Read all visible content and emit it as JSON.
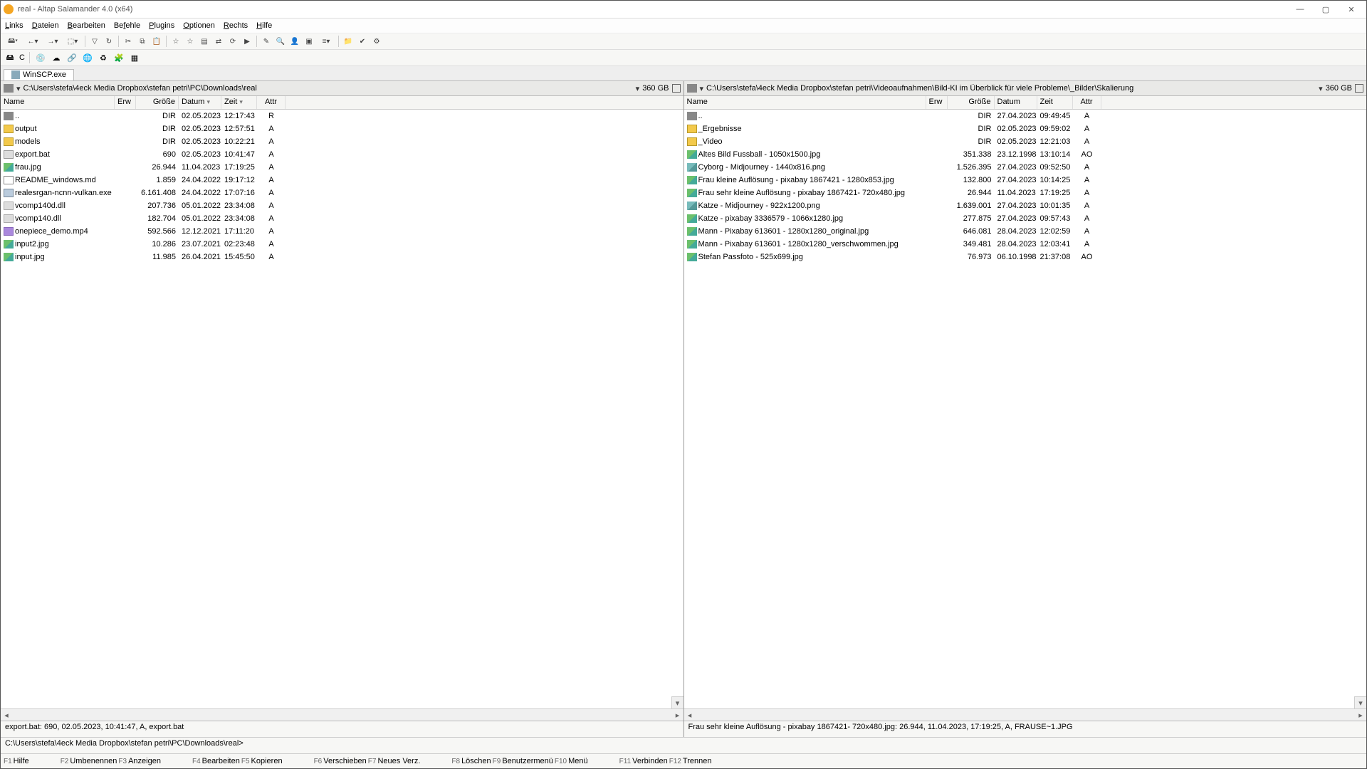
{
  "window": {
    "title": "real - Altap Salamander 4.0 (x64)"
  },
  "menu": {
    "links": "Links",
    "dateien": "Dateien",
    "bearbeiten": "Bearbeiten",
    "befehle": "Befehle",
    "plugins": "Plugins",
    "optionen": "Optionen",
    "rechts": "Rechts",
    "hilfe": "Hilfe"
  },
  "drivebar": {
    "c_label": "C"
  },
  "tab": {
    "winscp": "WinSCP.exe"
  },
  "left": {
    "path": "C:\\Users\\stefa\\4eck Media Dropbox\\stefan petri\\PC\\Downloads\\real",
    "free": "360 GB",
    "cols": {
      "name": "Name",
      "ext": "Erw",
      "size": "Größe",
      "date": "Datum",
      "time": "Zeit",
      "attr": "Attr"
    },
    "rows": [
      {
        "icon": "up",
        "name": "..",
        "size": "DIR",
        "date": "02.05.2023",
        "time": "12:17:43",
        "attr": "R"
      },
      {
        "icon": "folder",
        "name": "output",
        "size": "DIR",
        "date": "02.05.2023",
        "time": "12:57:51",
        "attr": "A"
      },
      {
        "icon": "folder",
        "name": "models",
        "size": "DIR",
        "date": "02.05.2023",
        "time": "10:22:21",
        "attr": "A"
      },
      {
        "icon": "bat",
        "name": "export.bat",
        "size": "690",
        "date": "02.05.2023",
        "time": "10:41:47",
        "attr": "A"
      },
      {
        "icon": "img",
        "name": "frau.jpg",
        "size": "26.944",
        "date": "11.04.2023",
        "time": "17:19:25",
        "attr": "A"
      },
      {
        "icon": "txt",
        "name": "README_windows.md",
        "size": "1.859",
        "date": "24.04.2022",
        "time": "19:17:12",
        "attr": "A"
      },
      {
        "icon": "exe",
        "name": "realesrgan-ncnn-vulkan.exe",
        "size": "6.161.408",
        "date": "24.04.2022",
        "time": "17:07:16",
        "attr": "A"
      },
      {
        "icon": "dll",
        "name": "vcomp140d.dll",
        "size": "207.736",
        "date": "05.01.2022",
        "time": "23:34:08",
        "attr": "A"
      },
      {
        "icon": "dll",
        "name": "vcomp140.dll",
        "size": "182.704",
        "date": "05.01.2022",
        "time": "23:34:08",
        "attr": "A"
      },
      {
        "icon": "mp4",
        "name": "onepiece_demo.mp4",
        "size": "592.566",
        "date": "12.12.2021",
        "time": "17:11:20",
        "attr": "A"
      },
      {
        "icon": "img",
        "name": "input2.jpg",
        "size": "10.286",
        "date": "23.07.2021",
        "time": "02:23:48",
        "attr": "A"
      },
      {
        "icon": "img",
        "name": "input.jpg",
        "size": "11.985",
        "date": "26.04.2021",
        "time": "15:45:50",
        "attr": "A"
      }
    ],
    "info": "export.bat: 690, 02.05.2023, 10:41:47, A, export.bat"
  },
  "right": {
    "path": "C:\\Users\\stefa\\4eck Media Dropbox\\stefan petri\\Videoaufnahmen\\Bild-KI im Überblick für viele Probleme\\_Bilder\\Skalierung",
    "free": "360 GB",
    "cols": {
      "name": "Name",
      "ext": "Erw",
      "size": "Größe",
      "date": "Datum",
      "time": "Zeit",
      "attr": "Attr"
    },
    "rows": [
      {
        "icon": "up",
        "name": "..",
        "size": "DIR",
        "date": "27.04.2023",
        "time": "09:49:45",
        "attr": "A"
      },
      {
        "icon": "folder",
        "name": "_Ergebnisse",
        "size": "DIR",
        "date": "02.05.2023",
        "time": "09:59:02",
        "attr": "A"
      },
      {
        "icon": "folder",
        "name": "_Video",
        "size": "DIR",
        "date": "02.05.2023",
        "time": "12:21:03",
        "attr": "A"
      },
      {
        "icon": "img",
        "name": "Altes Bild Fussball - 1050x1500.jpg",
        "size": "351.338",
        "date": "23.12.1998",
        "time": "13:10:14",
        "attr": "AO"
      },
      {
        "icon": "png",
        "name": "Cyborg - Midjourney - 1440x816.png",
        "size": "1.526.395",
        "date": "27.04.2023",
        "time": "09:52:50",
        "attr": "A"
      },
      {
        "icon": "img",
        "name": "Frau kleine Auflösung - pixabay 1867421 - 1280x853.jpg",
        "size": "132.800",
        "date": "27.04.2023",
        "time": "10:14:25",
        "attr": "A"
      },
      {
        "icon": "img",
        "name": "Frau sehr kleine Auflösung - pixabay 1867421- 720x480.jpg",
        "size": "26.944",
        "date": "11.04.2023",
        "time": "17:19:25",
        "attr": "A"
      },
      {
        "icon": "png",
        "name": "Katze - Midjourney - 922x1200.png",
        "size": "1.639.001",
        "date": "27.04.2023",
        "time": "10:01:35",
        "attr": "A"
      },
      {
        "icon": "img",
        "name": "Katze - pixabay 3336579 - 1066x1280.jpg",
        "size": "277.875",
        "date": "27.04.2023",
        "time": "09:57:43",
        "attr": "A"
      },
      {
        "icon": "img",
        "name": "Mann - Pixabay 613601 - 1280x1280_original.jpg",
        "size": "646.081",
        "date": "28.04.2023",
        "time": "12:02:59",
        "attr": "A"
      },
      {
        "icon": "img",
        "name": "Mann - Pixabay 613601 - 1280x1280_verschwommen.jpg",
        "size": "349.481",
        "date": "28.04.2023",
        "time": "12:03:41",
        "attr": "A"
      },
      {
        "icon": "img",
        "name": "Stefan Passfoto - 525x699.jpg",
        "size": "76.973",
        "date": "06.10.1998",
        "time": "21:37:08",
        "attr": "AO"
      }
    ],
    "info": "Frau sehr kleine Auflösung - pixabay 1867421- 720x480.jpg: 26.944, 11.04.2023, 17:19:25, A, FRAUSE~1.JPG"
  },
  "cmd": {
    "prompt": "C:\\Users\\stefa\\4eck Media Dropbox\\stefan petri\\PC\\Downloads\\real>"
  },
  "fn": {
    "f1": {
      "key": "F1",
      "lbl": "Hilfe"
    },
    "f2": {
      "key": "F2",
      "lbl": "Umbenennen"
    },
    "f3": {
      "key": "F3",
      "lbl": "Anzeigen"
    },
    "f4": {
      "key": "F4",
      "lbl": "Bearbeiten"
    },
    "f5": {
      "key": "F5",
      "lbl": "Kopieren"
    },
    "f6": {
      "key": "F6",
      "lbl": "Verschieben"
    },
    "f7": {
      "key": "F7",
      "lbl": "Neues Verz."
    },
    "f8": {
      "key": "F8",
      "lbl": "Löschen"
    },
    "f9": {
      "key": "F9",
      "lbl": "Benutzermenü"
    },
    "f10": {
      "key": "F10",
      "lbl": "Menü"
    },
    "f11": {
      "key": "F11",
      "lbl": "Verbinden"
    },
    "f12": {
      "key": "F12",
      "lbl": "Trennen"
    }
  }
}
